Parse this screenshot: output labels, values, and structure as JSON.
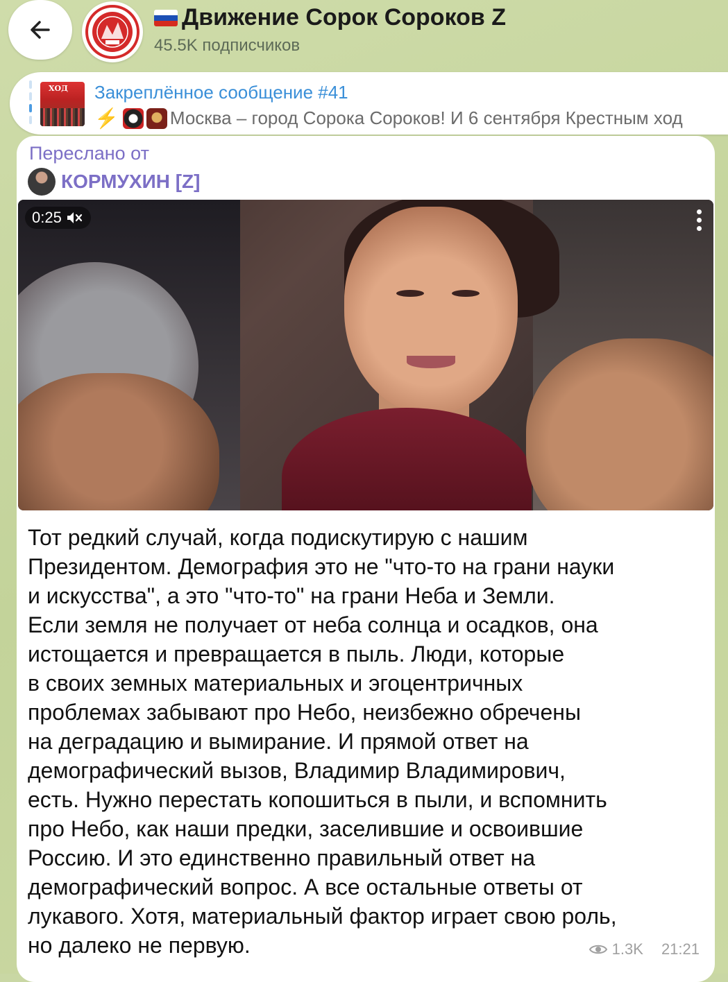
{
  "header": {
    "back_icon": "arrow-left-icon",
    "channel_name": "Движение Сорок Сороков Z",
    "subscribers": "45.5K подписчиков",
    "colors": {
      "title": "#1a1a1a",
      "subtitle": "#5d6b57"
    }
  },
  "pinned": {
    "title": "Закреплённое сообщение #41",
    "text": "Москва – город Сорока Сороков! И 6 сентября Крестным ход",
    "thumb_caption": "ХОД",
    "title_color": "#3a8fd8"
  },
  "message": {
    "forwarded_label": "Переслано от",
    "forwarded_from": "КОРМУХИН [Z]",
    "video": {
      "duration": "0:25",
      "muted_icon": "speaker-muted-icon",
      "menu_icon": "more-vertical-icon"
    },
    "lines": [
      "Тот редкий случай, когда подискутирую с нашим",
      "Президентом. Демография это не \"что-то на грани науки",
      "и искусства\", а это \"что-то\" на грани Неба и Земли.",
      "Если земля не получает от неба солнца и осадков, она",
      "истощается и превращается в пыль. Люди, которые",
      "в своих земных материальных и эгоцентричных",
      "проблемах забывают про Небо, неизбежно обречены",
      "на деградацию и вымирание. И прямой ответ на",
      "демографический вызов, Владимир Владимирович,",
      "есть. Нужно перестать копошиться в пыли, и вспомнить",
      "про Небо, как наши предки, заселившие и освоившие",
      "Россию. И это единственно правильный ответ на",
      "демографический вопрос. А все остальные ответы от",
      "лукавого. Хотя, материальный фактор играет свою роль,",
      "но далеко не первую."
    ],
    "views": "1.3K",
    "time": "21:21",
    "forward_color": "#7c6fc6"
  }
}
